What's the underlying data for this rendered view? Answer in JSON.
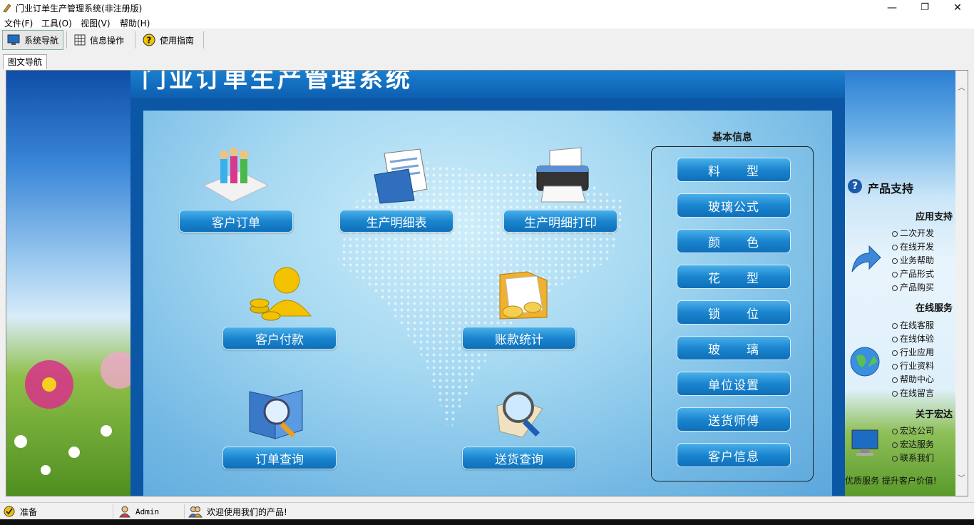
{
  "window": {
    "title": "门业订单生产管理系统(非注册版)",
    "minimize": "—",
    "maximize": "❐",
    "close": "✕"
  },
  "menu": [
    "文件(F)",
    "工具(O)",
    "视图(V)",
    "帮助(H)"
  ],
  "toolbar": [
    {
      "label": "系统导航",
      "icon": "monitor-icon"
    },
    {
      "label": "信息操作",
      "icon": "grid-icon"
    },
    {
      "label": "使用指南",
      "icon": "help-icon"
    }
  ],
  "tab": {
    "label": "图文导航"
  },
  "header": {
    "title": "门业订单生产管理系统"
  },
  "main_buttons": {
    "customer_order": "客户订单",
    "production_detail": "生产明细表",
    "production_print": "生产明细打印",
    "customer_payment": "客户付款",
    "account_stats": "账款统计",
    "order_query": "订单查询",
    "delivery_query": "送货查询"
  },
  "basic_info": {
    "title": "基本信息",
    "items": [
      "料　　型",
      "玻璃公式",
      "颜　　色",
      "花　　型",
      "锁　　位",
      "玻　　璃",
      "单位设置",
      "送货师傅",
      "客户信息"
    ]
  },
  "support": {
    "title": "产品支持",
    "sections": [
      {
        "heading": "应用支持",
        "items": [
          "二次开发",
          "在线开发",
          "业务帮助",
          "产品形式",
          "产品购买"
        ]
      },
      {
        "heading": "在线服务",
        "items": [
          "在线客服",
          "在线体验",
          "行业应用",
          "行业资料",
          "帮助中心",
          "在线留言"
        ]
      },
      {
        "heading": "关于宏达",
        "items": [
          "宏达公司",
          "宏达服务",
          "联系我们"
        ]
      }
    ],
    "footer": "优质服务  提升客户价值!"
  },
  "status": {
    "ready": "准备",
    "user": "Admin",
    "welcome": "欢迎使用我们的产品!"
  }
}
